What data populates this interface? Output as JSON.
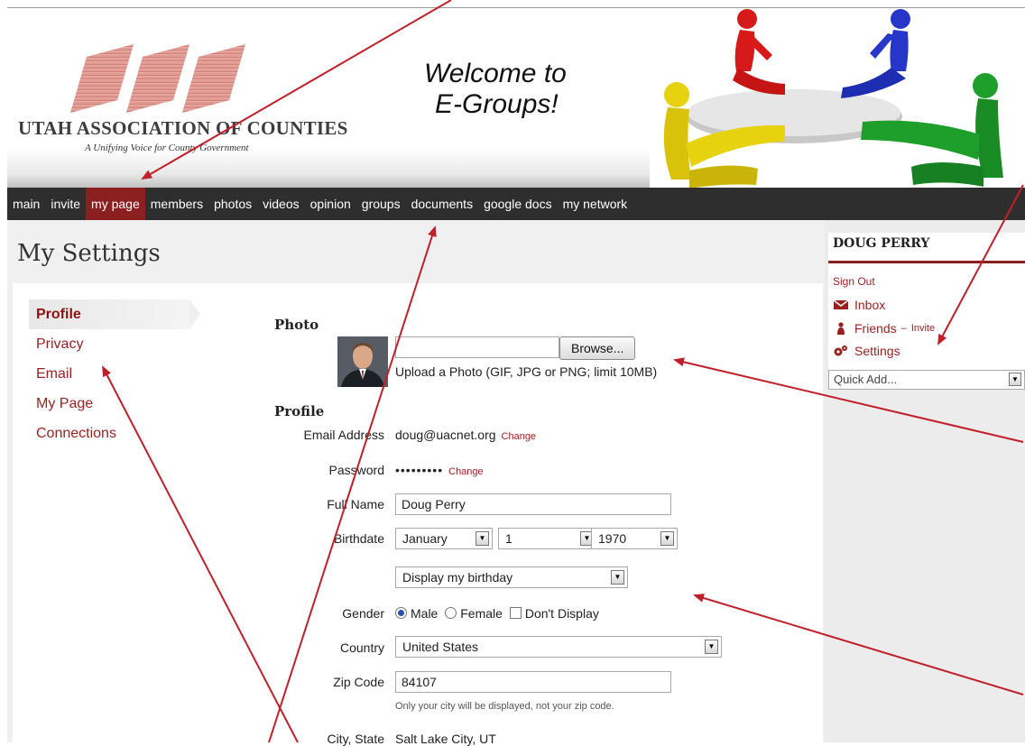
{
  "header": {
    "org_name": "UTAH ASSOCIATION OF COUNTIES",
    "org_tagline": "A Unifying Voice for County Government",
    "welcome_line1": "Welcome to",
    "welcome_line2": "E-Groups!"
  },
  "nav": {
    "items": [
      {
        "label": "main"
      },
      {
        "label": "invite"
      },
      {
        "label": "my page",
        "active": true
      },
      {
        "label": "members"
      },
      {
        "label": "photos"
      },
      {
        "label": "videos"
      },
      {
        "label": "opinion"
      },
      {
        "label": "groups"
      },
      {
        "label": "documents"
      },
      {
        "label": "google docs"
      },
      {
        "label": "my network"
      }
    ]
  },
  "page_title": "My Settings",
  "settings_menu": {
    "items": [
      {
        "label": "Profile",
        "active": true
      },
      {
        "label": "Privacy"
      },
      {
        "label": "Email"
      },
      {
        "label": "My Page"
      },
      {
        "label": "Connections"
      }
    ]
  },
  "photo_section": {
    "title": "Photo",
    "browse_label": "Browse...",
    "file_value": "",
    "hint": "Upload a Photo (GIF, JPG or PNG; limit 10MB)"
  },
  "profile_section": {
    "title": "Profile",
    "email_label": "Email Address",
    "email_value": "doug@uacnet.org",
    "change_label": "Change",
    "password_label": "Password",
    "password_value": "•••••••••",
    "full_name_label": "Full Name",
    "full_name_value": "Doug Perry",
    "birthdate_label": "Birthdate",
    "birth_month": "January",
    "birth_day": "1",
    "birth_year": "1970",
    "birthday_display": "Display my birthday",
    "gender_label": "Gender",
    "gender_options": [
      "Male",
      "Female",
      "Don't Display"
    ],
    "gender_selected": "Male",
    "country_label": "Country",
    "country_value": "United States",
    "zip_label": "Zip Code",
    "zip_value": "84107",
    "zip_hint": "Only your city will be displayed, not your zip code.",
    "city_label": "City, State",
    "city_value": "Salt Lake City, UT"
  },
  "sidebar": {
    "user_name": "DOUG PERRY",
    "sign_out": "Sign Out",
    "inbox": "Inbox",
    "friends": "Friends",
    "friends_sep": "–",
    "invite": "Invite",
    "settings": "Settings",
    "quick_add": "Quick Add..."
  },
  "colors": {
    "accent": "#8c1f1f",
    "link": "#9a1f1f",
    "navbar": "#2e2e2e",
    "annotation_arrow": "#c0202a"
  },
  "icons": [
    "envelope-icon",
    "person-icon",
    "gears-icon",
    "chevron-down-icon"
  ]
}
